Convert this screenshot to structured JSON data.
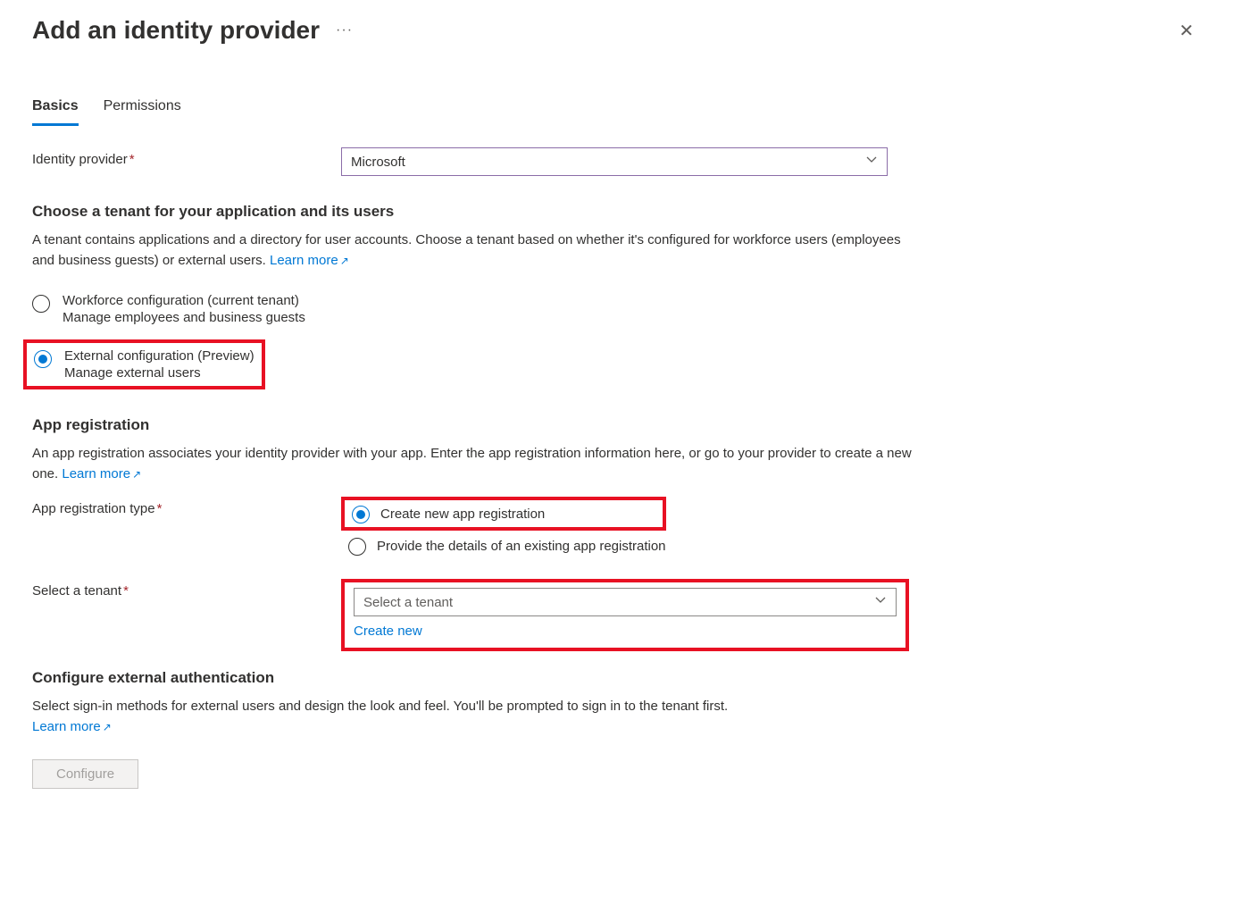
{
  "header": {
    "title": "Add an identity provider",
    "more": "···",
    "close": "✕"
  },
  "tabs": {
    "basics": "Basics",
    "permissions": "Permissions"
  },
  "identity_provider": {
    "label": "Identity provider",
    "value": "Microsoft"
  },
  "tenant_section": {
    "heading": "Choose a tenant for your application and its users",
    "desc": "A tenant contains applications and a directory for user accounts. Choose a tenant based on whether it's configured for workforce users (employees and business guests) or external users. ",
    "learn_more": "Learn more"
  },
  "tenant_options": {
    "workforce": {
      "label": "Workforce configuration (current tenant)",
      "sub": "Manage employees and business guests"
    },
    "external": {
      "label": "External configuration (Preview)",
      "sub": "Manage external users"
    }
  },
  "app_reg": {
    "heading": "App registration",
    "desc": "An app registration associates your identity provider with your app. Enter the app registration information here, or go to your provider to create a new one. ",
    "learn_more": "Learn more",
    "type_label": "App registration type",
    "opt_create": "Create new app registration",
    "opt_existing": "Provide the details of an existing app registration"
  },
  "select_tenant": {
    "label": "Select a tenant",
    "placeholder": "Select a tenant",
    "create_new": "Create new"
  },
  "ext_auth": {
    "heading": "Configure external authentication",
    "desc": "Select sign-in methods for external users and design the look and feel. You'll be prompted to sign in to the tenant first.",
    "learn_more": "Learn more",
    "btn": "Configure"
  }
}
